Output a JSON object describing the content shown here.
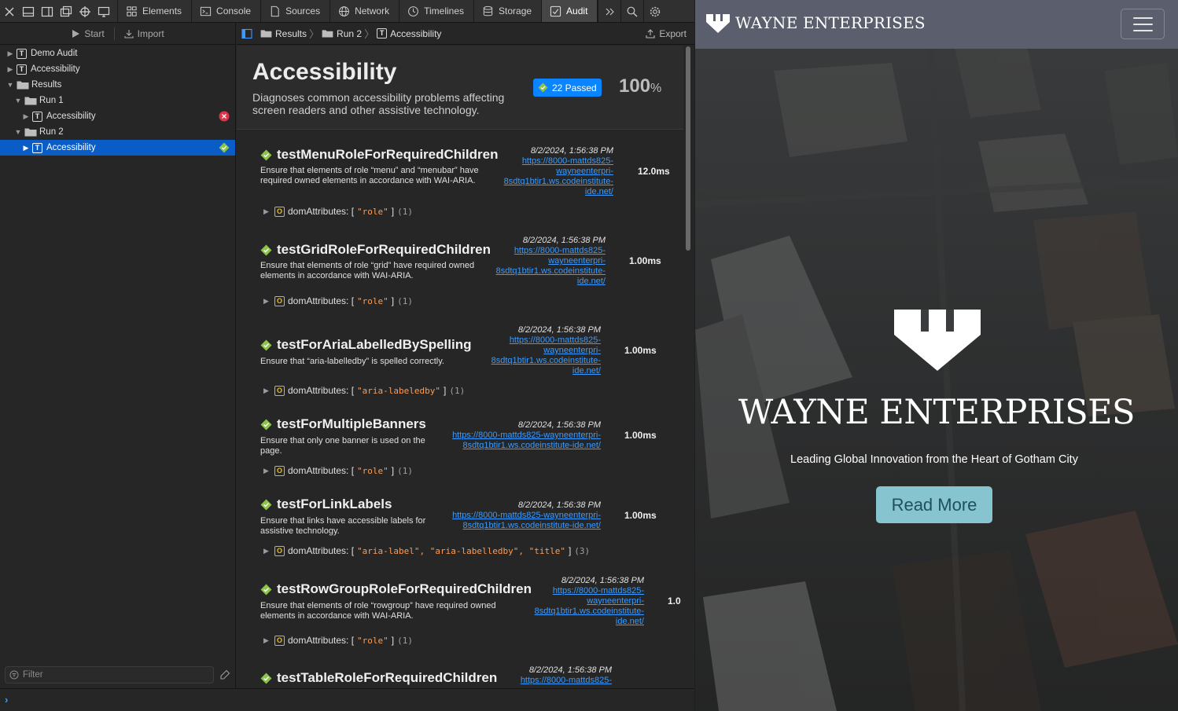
{
  "devtools": {
    "tabs": [
      {
        "label": "Elements",
        "icon": "elements-icon"
      },
      {
        "label": "Console",
        "icon": "console-icon"
      },
      {
        "label": "Sources",
        "icon": "sources-icon"
      },
      {
        "label": "Network",
        "icon": "network-icon"
      },
      {
        "label": "Timelines",
        "icon": "timelines-icon"
      },
      {
        "label": "Storage",
        "icon": "storage-icon"
      },
      {
        "label": "Audit",
        "icon": "audit-icon",
        "active": true
      }
    ],
    "sidebar": {
      "start_label": "Start",
      "import_label": "Import",
      "tree": [
        {
          "label": "Demo Audit",
          "type": "test",
          "depth": 0
        },
        {
          "label": "Accessibility",
          "type": "test",
          "depth": 0
        },
        {
          "label": "Results",
          "type": "folder",
          "depth": 0,
          "expanded": true
        },
        {
          "label": "Run 1",
          "type": "folder",
          "depth": 1,
          "expanded": true
        },
        {
          "label": "Accessibility",
          "type": "test",
          "depth": 2,
          "status": "failed"
        },
        {
          "label": "Run 2",
          "type": "folder",
          "depth": 1,
          "expanded": true
        },
        {
          "label": "Accessibility",
          "type": "test",
          "depth": 2,
          "status": "passed",
          "selected": true
        }
      ],
      "filter_placeholder": "Filter"
    },
    "breadcrumbs": [
      "Results",
      "Run 2",
      "Accessibility"
    ],
    "export_label": "Export",
    "audit": {
      "title": "Accessibility",
      "description": "Diagnoses common accessibility problems affecting screen readers and other assistive technology.",
      "passed_label": "22 Passed",
      "score": "100",
      "score_unit": "%"
    },
    "tests": [
      {
        "name": "testMenuRoleForRequiredChildren",
        "description": "Ensure that elements of role “menu” and “menubar” have required owned elements in accordance with WAI-ARIA.",
        "date": "8/2/2024, 1:56:38 PM",
        "url": "https://8000-mattds825-wayneenterpri-8sdtq1btir1.ws.codeinstitute-ide.net/",
        "duration": "12.0ms",
        "attr_prefix": "domAttributes: [",
        "attr_values": "\"role\"",
        "attr_suffix": "]",
        "attr_count": "(1)"
      },
      {
        "name": "testGridRoleForRequiredChildren",
        "description": "Ensure that elements of role “grid” have required owned elements in accordance with WAI-ARIA.",
        "date": "8/2/2024, 1:56:38 PM",
        "url": "https://8000-mattds825-wayneenterpri-8sdtq1btir1.ws.codeinstitute-ide.net/",
        "duration": "1.00ms",
        "attr_prefix": "domAttributes: [",
        "attr_values": "\"role\"",
        "attr_suffix": "]",
        "attr_count": "(1)"
      },
      {
        "name": "testForAriaLabelledBySpelling",
        "description": "Ensure that “aria-labelledby” is spelled correctly.",
        "date": "8/2/2024, 1:56:38 PM",
        "url": "https://8000-mattds825-wayneenterpri-8sdtq1btir1.ws.codeinstitute-ide.net/",
        "duration": "1.00ms",
        "attr_prefix": "domAttributes: [",
        "attr_values": "\"aria-labeledby\"",
        "attr_suffix": "]",
        "attr_count": "(1)"
      },
      {
        "name": "testForMultipleBanners",
        "description": "Ensure that only one banner is used on the page.",
        "date": "8/2/2024, 1:56:38 PM",
        "url": "https://8000-mattds825-wayneenterpri-8sdtq1btir1.ws.codeinstitute-ide.net/",
        "duration": "1.00ms",
        "attr_prefix": "domAttributes: [",
        "attr_values": "\"role\"",
        "attr_suffix": "]",
        "attr_count": "(1)"
      },
      {
        "name": "testForLinkLabels",
        "description": "Ensure that links have accessible labels for assistive technology.",
        "date": "8/2/2024, 1:56:38 PM",
        "url": "https://8000-mattds825-wayneenterpri-8sdtq1btir1.ws.codeinstitute-ide.net/",
        "duration": "1.00ms",
        "attr_prefix": "domAttributes: [",
        "attr_values": "\"aria-label\", \"aria-labelledby\", \"title\"",
        "attr_suffix": "]",
        "attr_count": "(3)"
      },
      {
        "name": "testRowGroupRoleForRequiredChildren",
        "description": "Ensure that elements of role “rowgroup” have required owned elements in accordance with WAI-ARIA.",
        "date": "8/2/2024, 1:56:38 PM",
        "url": "https://8000-mattds825-wayneenterpri-8sdtq1btir1.ws.codeinstitute-ide.net/",
        "duration": "1.0",
        "attr_prefix": "domAttributes: [",
        "attr_values": "\"role\"",
        "attr_suffix": "]",
        "attr_count": "(1)"
      },
      {
        "name": "testTableRoleForRequiredChildren",
        "description": "",
        "date": "8/2/2024, 1:56:38 PM",
        "url": "https://8000-mattds825-",
        "duration": "",
        "attr_prefix": "",
        "attr_values": "",
        "attr_suffix": "",
        "attr_count": ""
      }
    ],
    "colors": {
      "accent": "#0a84ff",
      "selection": "#0a5cc7",
      "link": "#3b9bff",
      "pass": "#8cc34a",
      "fail": "#e0334a"
    }
  },
  "site": {
    "brand": "WAYNE ENTERPRISES",
    "hero_title": "WAYNE ENTERPRISES",
    "hero_subtitle": "Leading Global Innovation from the Heart of Gotham City",
    "cta_label": "Read More",
    "nav_color": "#5b5f6d",
    "cta_color": "#86c5cf"
  }
}
